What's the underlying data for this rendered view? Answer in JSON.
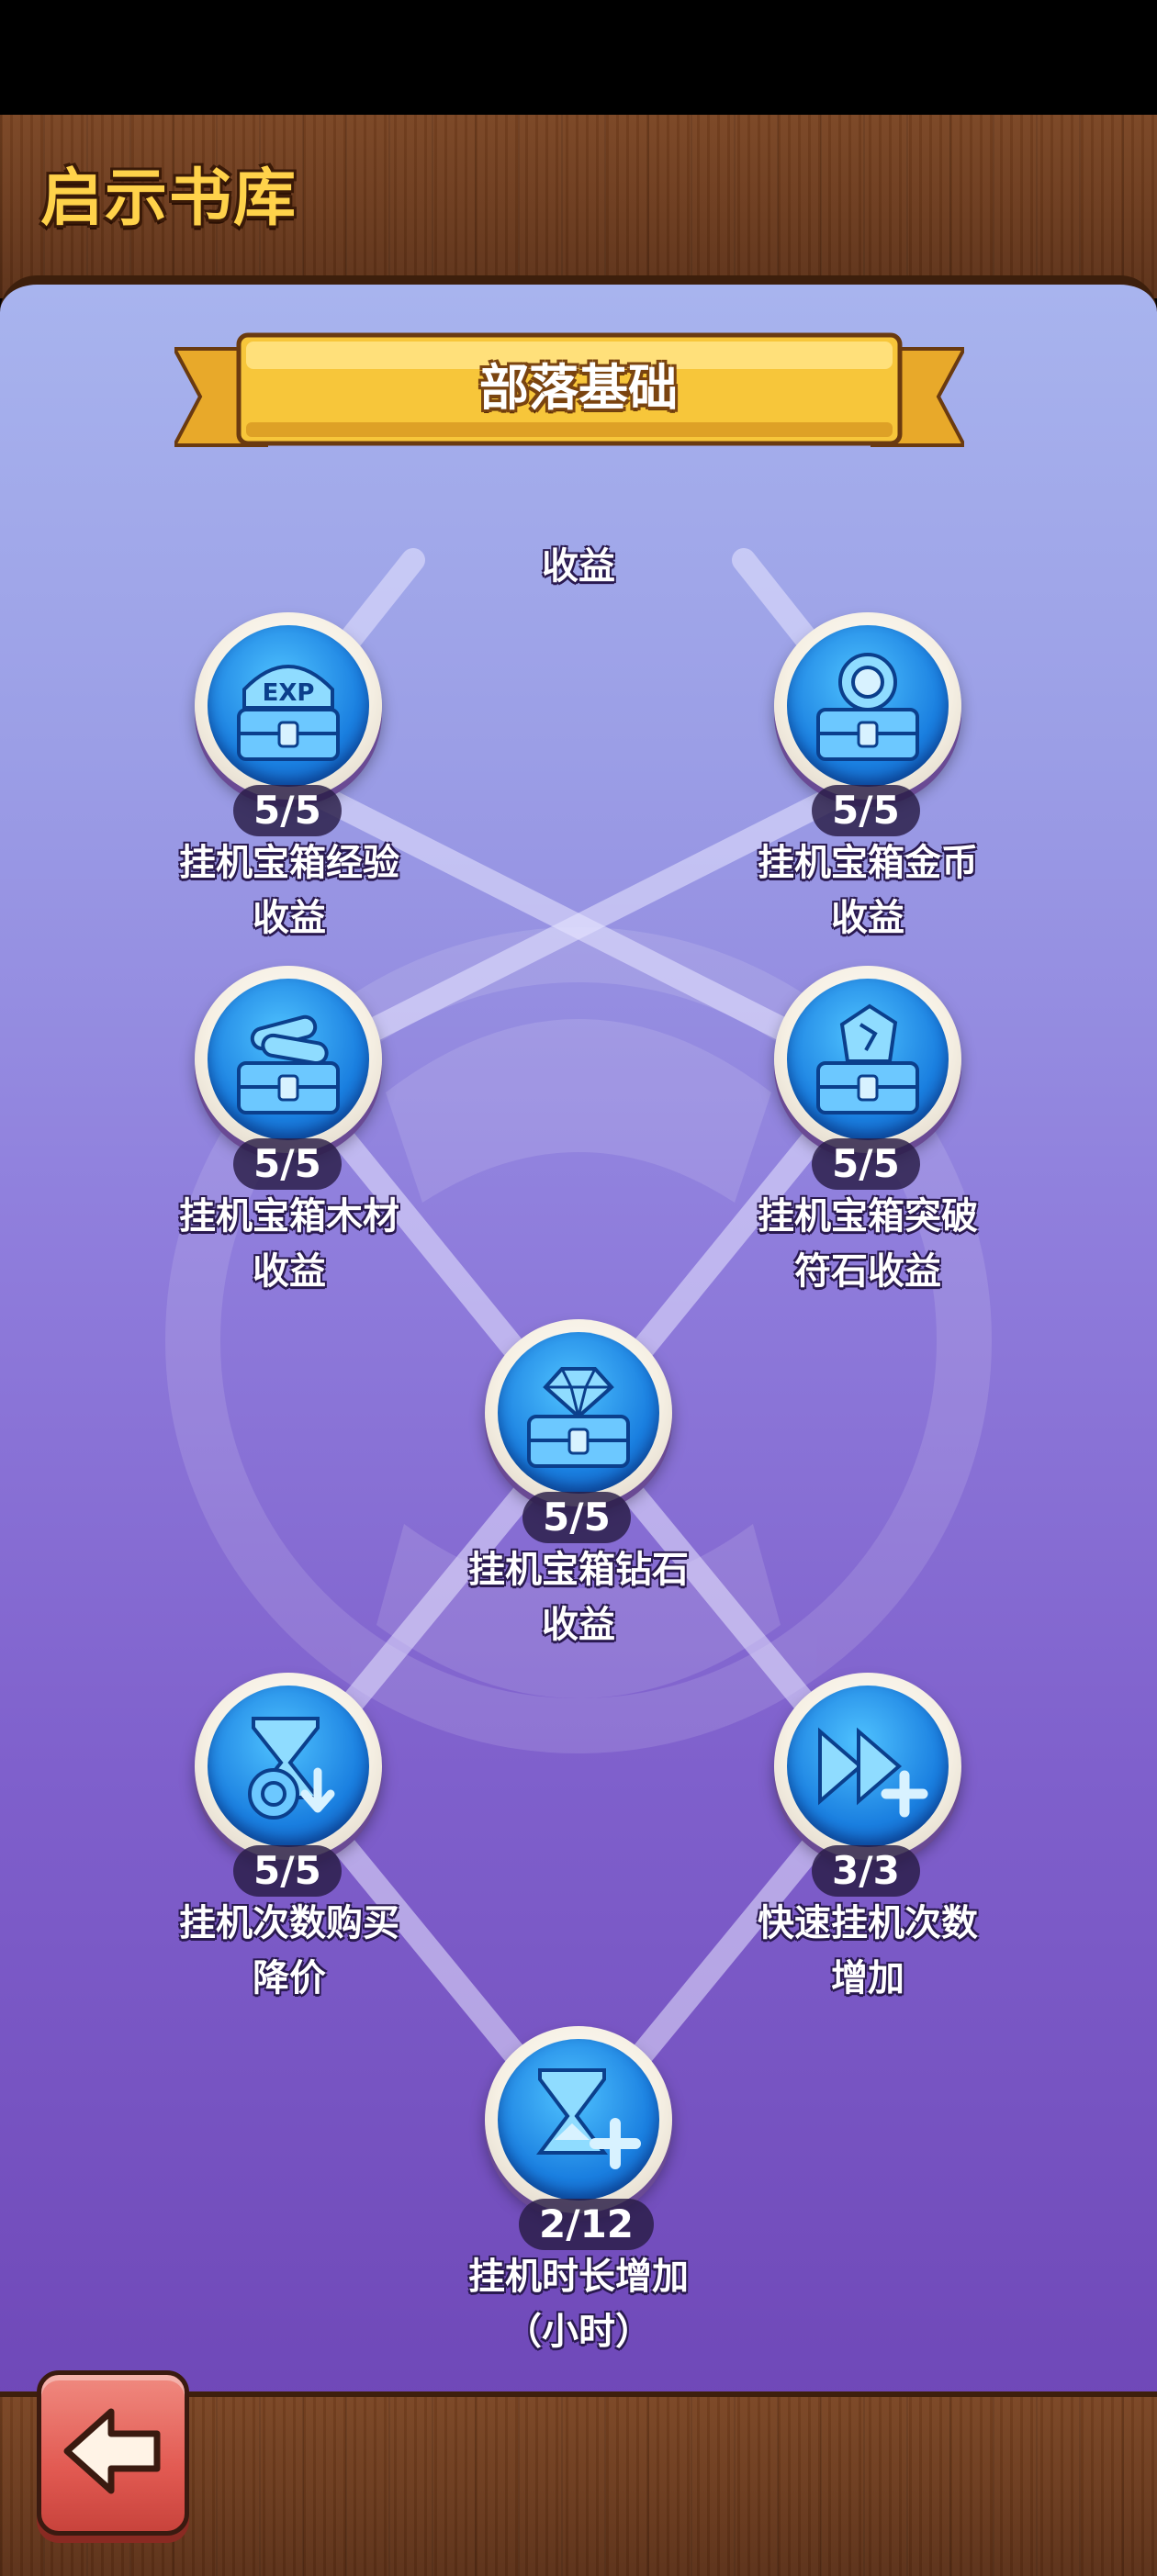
{
  "header": {
    "title": "启示书库"
  },
  "section": {
    "title": "部落基础"
  },
  "top_partial_label": "收益",
  "nodes": [
    {
      "id": "exp",
      "progress": "5/5",
      "label_line1": "挂机宝箱经验",
      "label_line2": "收益",
      "icon": "exp-chest-icon"
    },
    {
      "id": "gold",
      "progress": "5/5",
      "label_line1": "挂机宝箱金币",
      "label_line2": "收益",
      "icon": "gold-chest-icon"
    },
    {
      "id": "wood",
      "progress": "5/5",
      "label_line1": "挂机宝箱木材",
      "label_line2": "收益",
      "icon": "wood-chest-icon"
    },
    {
      "id": "rune",
      "progress": "5/5",
      "label_line1": "挂机宝箱突破",
      "label_line2": "符石收益",
      "icon": "rune-chest-icon"
    },
    {
      "id": "diamond",
      "progress": "5/5",
      "label_line1": "挂机宝箱钻石",
      "label_line2": "收益",
      "icon": "diamond-chest-icon"
    },
    {
      "id": "discount",
      "progress": "5/5",
      "label_line1": "挂机次数购买",
      "label_line2": "降价",
      "icon": "hourglass-discount-icon"
    },
    {
      "id": "fast",
      "progress": "3/3",
      "label_line1": "快速挂机次数",
      "label_line2": "增加",
      "icon": "fast-forward-plus-icon"
    },
    {
      "id": "duration",
      "progress": "2/12",
      "label_line1": "挂机时长增加",
      "label_line2": "（小时）",
      "icon": "hourglass-plus-icon"
    }
  ],
  "colors": {
    "title_yellow": "#ffd24a",
    "ribbon_yellow": "#f7c63a",
    "node_blue": "#1a7fe0",
    "back_button_red": "#e25a52"
  },
  "back_button": {
    "icon": "back-arrow-icon"
  }
}
